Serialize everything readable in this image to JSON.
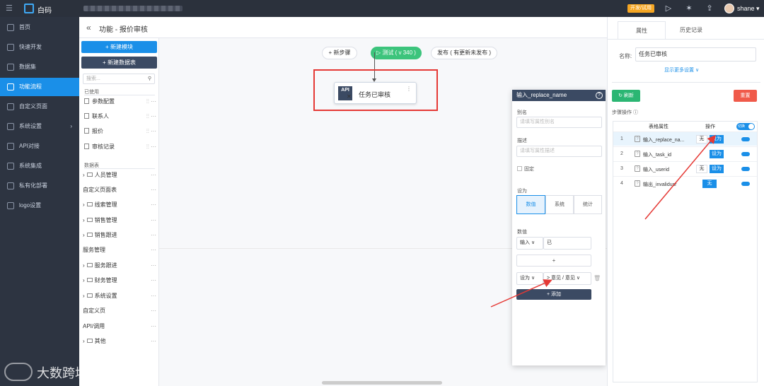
{
  "topbar": {
    "brand": "白码",
    "dev_badge": "开发/试用",
    "user": "shane"
  },
  "sidebar": {
    "items": [
      {
        "label": "首页"
      },
      {
        "label": "快速开发"
      },
      {
        "label": "数据集"
      },
      {
        "label": "功能流程"
      },
      {
        "label": "自定义页面"
      },
      {
        "label": "系统设置"
      },
      {
        "label": "API对接"
      },
      {
        "label": "系统集成"
      },
      {
        "label": "私有化部署"
      },
      {
        "label": "logo设置"
      }
    ],
    "active_index": 3,
    "watermark": "大数跨境"
  },
  "header": {
    "title": "功能 - 报价审核"
  },
  "left_panel": {
    "new_module": "+ 新建模块",
    "new_table": "+ 新建数据表",
    "search_placeholder": "搜索...",
    "used_section": "已使用",
    "used_items": [
      "参数配置",
      "联系人",
      "报价",
      "审核记录"
    ],
    "tables_section": "数据表",
    "tree": [
      "人员管理",
      "自定义页面表",
      "线索管理",
      "销售管理",
      "销售跟进",
      "服务管理",
      "服务跟进",
      "财务管理",
      "系统设置",
      "自定义页",
      "API/调用",
      "其他"
    ]
  },
  "canvas": {
    "new_step": "+ 新步骤",
    "test": "▷ 测试 ( v 340 )",
    "publish": "发布 ( 有更新未发布 )",
    "node": {
      "badge": "API",
      "title": "任务已审核"
    }
  },
  "popup": {
    "title": "输入_replace_name",
    "alias_label": "别名",
    "alias_placeholder": "请填写属性别名",
    "desc_label": "描述",
    "desc_placeholder": "请填写属性描述",
    "fixed_label": "固定",
    "set_label": "设为",
    "segments": [
      "数值",
      "系统",
      "统计"
    ],
    "value_label": "数值",
    "input_select": "输入",
    "input_value": "已",
    "plus": "+",
    "set_select": "设为",
    "set_value": "> 意见 / 意见",
    "add_button": "+ 添加"
  },
  "right_panel": {
    "tabs": [
      "属性",
      "历史记录"
    ],
    "name_label": "名称:",
    "name_value": "任务已审核",
    "show_more": "显示更多设置 ∨",
    "refresh": "↻ 刷新",
    "reset": "重置",
    "steps_label": "步骤操作",
    "col_attr": "表格属性",
    "col_op": "操作",
    "toggle": "切换",
    "rows": [
      {
        "num": "1",
        "name": "输入_replace_na...",
        "none": "无",
        "set": "设为"
      },
      {
        "num": "2",
        "name": "输入_task_id",
        "none": "",
        "set": "设为"
      },
      {
        "num": "3",
        "name": "输入_userid",
        "none": "无",
        "set": "设为"
      },
      {
        "num": "4",
        "name": "输出_invalidusr",
        "none": "",
        "set": "无"
      }
    ]
  },
  "colors": {
    "accent": "#1a8fe8",
    "sidebar_bg": "#2d3441",
    "test_green": "#3cc47c",
    "highlight_red": "#e53935"
  }
}
